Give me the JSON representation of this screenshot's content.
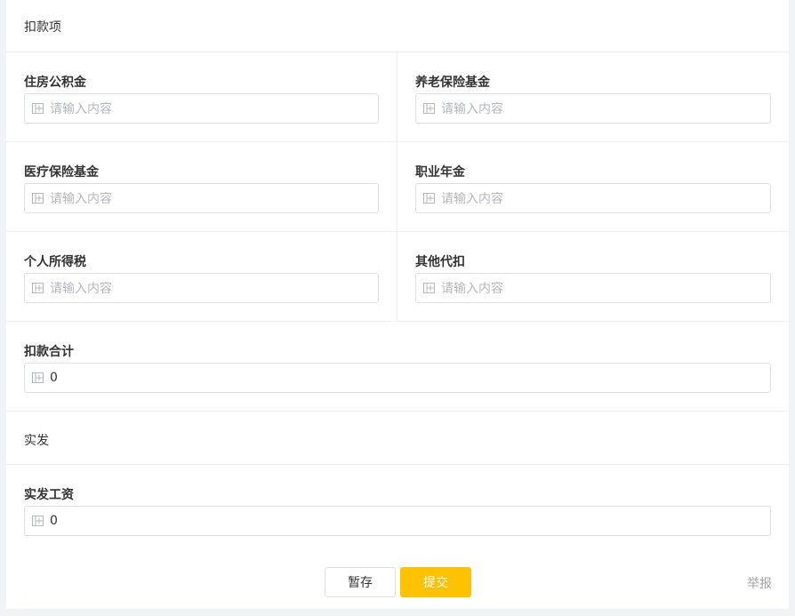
{
  "deductions": {
    "section_title": "扣款项",
    "fields": {
      "housing_fund": {
        "label": "住房公积金",
        "placeholder": "请输入内容"
      },
      "pension_fund": {
        "label": "养老保险基金",
        "placeholder": "请输入内容"
      },
      "medical_fund": {
        "label": "医疗保险基金",
        "placeholder": "请输入内容"
      },
      "occupational_annuity": {
        "label": "职业年金",
        "placeholder": "请输入内容"
      },
      "income_tax": {
        "label": "个人所得税",
        "placeholder": "请输入内容"
      },
      "other_deductions": {
        "label": "其他代扣",
        "placeholder": "请输入内容"
      },
      "total": {
        "label": "扣款合计",
        "value": "0"
      }
    }
  },
  "actual": {
    "section_title": "实发",
    "fields": {
      "net_salary": {
        "label": "实发工资",
        "value": "0"
      }
    }
  },
  "footer": {
    "save_label": "暂存",
    "submit_label": "提交",
    "report_label": "举报"
  },
  "colors": {
    "accent": "#ffc200",
    "border": "#dcdfe6",
    "placeholder": "#b4b7bd"
  },
  "icons": {
    "input_prefix": "calendar-grid-icon"
  }
}
